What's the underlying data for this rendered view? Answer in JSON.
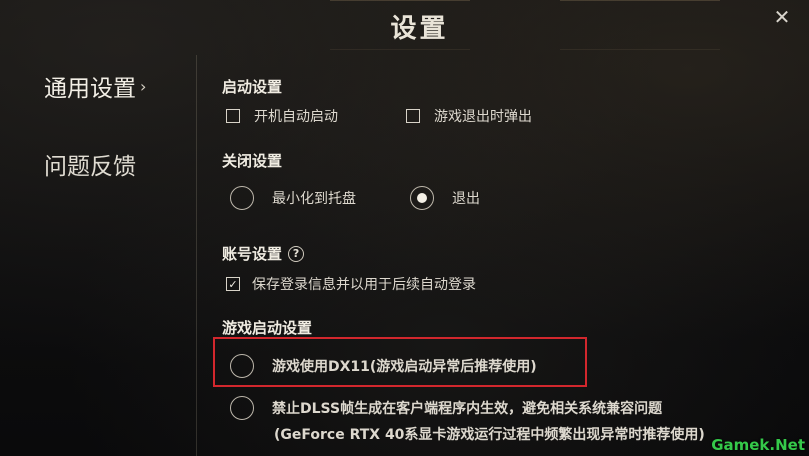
{
  "header": {
    "title": "设置",
    "close_icon": "close-icon"
  },
  "sidebar": {
    "items": [
      {
        "label": "通用设置",
        "active": true,
        "chevron": "›"
      },
      {
        "label": "问题反馈",
        "active": false
      }
    ]
  },
  "sections": {
    "startup": {
      "title": "启动设置",
      "options": [
        {
          "label": "开机自动启动",
          "checked": false
        },
        {
          "label": "游戏退出时弹出",
          "checked": false
        }
      ]
    },
    "close": {
      "title": "关闭设置",
      "options": [
        {
          "label": "最小化到托盘",
          "selected": false
        },
        {
          "label": "退出",
          "selected": true
        }
      ]
    },
    "account": {
      "title": "账号设置",
      "help_icon": "?",
      "options": [
        {
          "label": "保存登录信息并以用于后续自动登录",
          "checked": true,
          "check_mark": "✓"
        }
      ]
    },
    "game_launch": {
      "title": "游戏启动设置",
      "options": [
        {
          "label": "游戏使用DX11(游戏启动异常后推荐使用)",
          "selected": false
        },
        {
          "label": "禁止DLSS帧生成在客户端程序内生效，避免相关系统兼容问题",
          "note": "(GeForce RTX 40系显卡游戏运行过程中频繁出现异常时推荐使用)",
          "selected": false
        }
      ]
    }
  },
  "watermark": "Gamek.Net",
  "colors": {
    "highlight_border": "#d2272d",
    "watermark": "#35c94a"
  }
}
